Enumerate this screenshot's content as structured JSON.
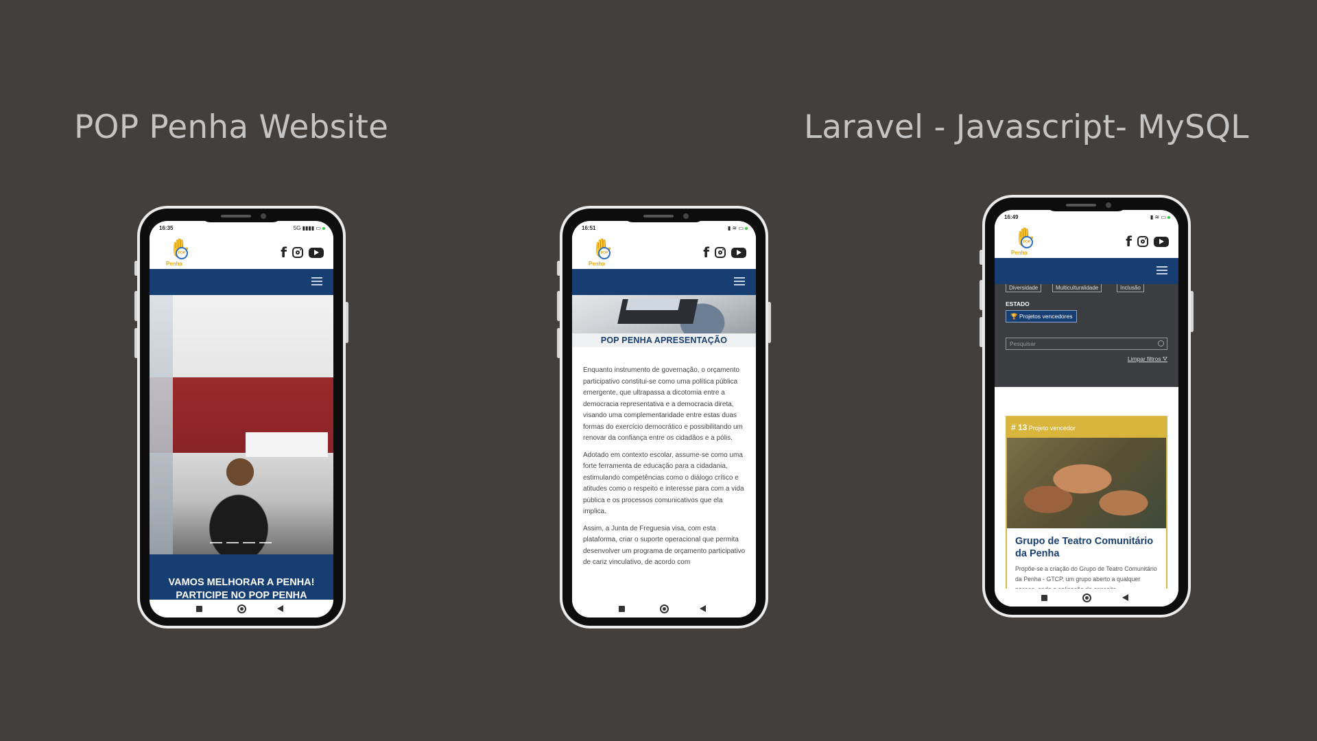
{
  "headings": {
    "left": "POP Penha Website",
    "right": "Laravel - Javascript- MySQL"
  },
  "logo": {
    "word": "Penha",
    "badge": "POP"
  },
  "phones": {
    "p1": {
      "time": "16:35",
      "status_icons": "5G ▮▮▮▮ ▭",
      "banner_line1": "VAMOS MELHORAR A PENHA!",
      "banner_line2": "PARTICIPE NO POP PENHA"
    },
    "p2": {
      "time": "16:51",
      "status_icons": "▮ ≋ ▭",
      "section_title": "POP PENHA APRESENTAÇÃO",
      "paragraphs": [
        "Enquanto instrumento de governação, o orçamento participativo constitui-se como uma política pública emergente, que ultrapassa a dicotomia entre a democracia representativa e a democracia direta, visando uma complementaridade entre estas duas formas do exercício democrático e possibilitando um renovar da confiança entre os cidadãos e a pólis.",
        "Adotado em contexto escolar, assume-se como uma forte ferramenta de educação para a cidadania, estimulando competências como o diálogo crítico e atitudes como o respeito e interesse para com a vida pública e os processos comunicativos que ela implica.",
        "Assim, a Junta de Freguesia visa, com esta plataforma, criar o suporte operacional que permita desenvolver um programa de orçamento participativo de cariz vinculativo, de acordo com"
      ]
    },
    "p3": {
      "time": "16:49",
      "status_icons": "▮ ≋ ▭",
      "chips": [
        "Diversidade",
        "Multiculturalidade",
        "Inclusão"
      ],
      "estado_label": "ESTADO",
      "winner_button": "Projetos vencedores",
      "search_placeholder": "Pesquisar",
      "clear_filters": "Limpar filtros",
      "card": {
        "number": "# 13",
        "tag": "Projeto vencedor",
        "title": "Grupo de Teatro Comunitário da Penha",
        "description": "Propõe-se a criação do Grupo de Teatro Comunitário da Penha - GTCP, um grupo aberto a qualquer pessoa, onde a aplicação do conceito"
      }
    }
  }
}
